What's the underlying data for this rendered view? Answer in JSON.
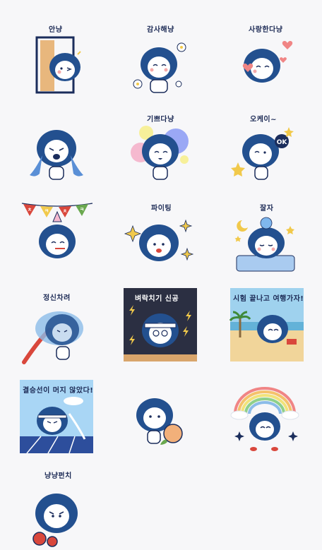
{
  "stickers": [
    {
      "name": "sticker-hello",
      "caption": "안냥"
    },
    {
      "name": "sticker-thanks",
      "caption": "감사해냥"
    },
    {
      "name": "sticker-love",
      "caption": "사랑한다냥"
    },
    {
      "name": "sticker-crying",
      "caption": ""
    },
    {
      "name": "sticker-happy",
      "caption": "기쁘다냥"
    },
    {
      "name": "sticker-okay",
      "caption": "오케이~",
      "badge": "OK"
    },
    {
      "name": "sticker-congrats",
      "caption": "",
      "flags": [
        "ㅊ",
        "ㅋ",
        "ㅊ",
        "ㅋ"
      ]
    },
    {
      "name": "sticker-fighting",
      "caption": "파이팅"
    },
    {
      "name": "sticker-goodnight",
      "caption": "잘자"
    },
    {
      "name": "sticker-wake-up",
      "caption": "정신차려"
    },
    {
      "name": "sticker-crunch",
      "caption": "벼락치기 신공"
    },
    {
      "name": "sticker-travel",
      "caption": "시험 끝나고 여행가자!"
    },
    {
      "name": "sticker-finish-line",
      "caption": "결승선이 머지 않았다!"
    },
    {
      "name": "sticker-tangerine",
      "caption": ""
    },
    {
      "name": "sticker-rainbow",
      "caption": ""
    },
    {
      "name": "sticker-punch",
      "caption": "냥냥펀치"
    }
  ],
  "colors": {
    "mane": "#23508f",
    "face": "#ffffff",
    "outline": "#1b2d5c",
    "cheek": "#f5a9a9",
    "background": "#f7f7f9"
  }
}
